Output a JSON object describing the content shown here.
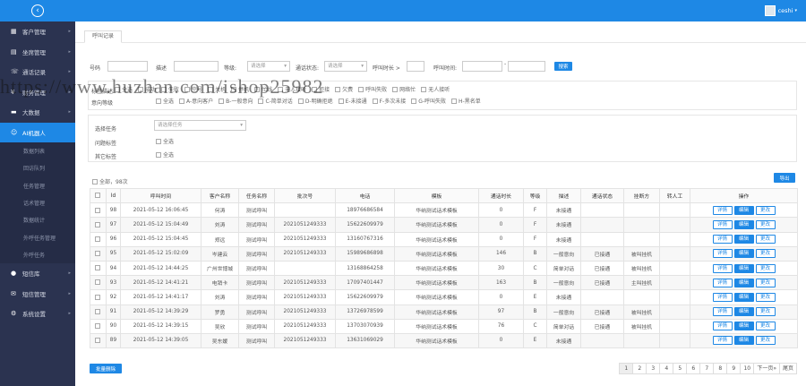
{
  "sidebar": {
    "items": [
      {
        "icon": "▦",
        "label": "客户管理"
      },
      {
        "icon": "▤",
        "label": "坐席管理"
      },
      {
        "icon": "☏",
        "label": "通话记录"
      },
      {
        "icon": "¥",
        "label": "财务管理"
      },
      {
        "icon": "▬",
        "label": "大数据"
      },
      {
        "icon": "☺",
        "label": "AI机器人"
      }
    ],
    "sub": [
      "数据列表",
      "回访队列",
      "任务管理",
      "话术管理",
      "数据统计",
      "外呼任务管理",
      "外呼任务"
    ],
    "items2": [
      {
        "icon": "●",
        "label": "短信库"
      },
      {
        "icon": "✉",
        "label": "短信管理"
      },
      {
        "icon": "⚙",
        "label": "系统设置"
      }
    ]
  },
  "topbar": {
    "user": "ceshi",
    "menu_icon": "‹"
  },
  "tab": "呼叫记录",
  "filters": {
    "phone_label": "号码",
    "desc_label": "描述",
    "level_label": "等级:",
    "level_ph": "请选择",
    "status_label": "通话状态:",
    "status_ph": "请选择",
    "duration_label": "呼叫时长 >",
    "time_label": "呼叫时间:",
    "time_sep": "-",
    "search_btn": "搜索"
  },
  "intent": {
    "row1_label": "标签描述",
    "row1": [
      "全选",
      "成功",
      "失败",
      "空号",
      "关机",
      "停机",
      "忙线",
      "无人接听",
      "拒接",
      "欠费",
      "呼叫失败",
      "网络忙",
      "无人接听"
    ],
    "row2_label": "意向等级",
    "row2": [
      "全选",
      "A-意向客户",
      "B-一般意向",
      "C-简单对话",
      "D-明确拒绝",
      "E-未接通",
      "F-多次未接",
      "G-呼叫失败",
      "H-黑名单"
    ]
  },
  "task": {
    "label": "选择任务",
    "placeholder": "请选择任务",
    "intent_label": "问题标签",
    "all": "全选",
    "tag_label": "其它标签"
  },
  "total": "全部，98次",
  "export_btn": "导出",
  "table": {
    "headers": [
      "",
      "Id",
      "呼叫时间",
      "客户名称",
      "任务名称",
      "批次号",
      "电话",
      "模板",
      "通话时长",
      "等级",
      "描述",
      "通话状态",
      "挂断方",
      "转人工",
      "操作"
    ],
    "rows": [
      [
        "98",
        "2021-05-12 16:06:45",
        "何涛",
        "测试呼叫",
        "",
        "18976686584",
        "华纳测试话术模板",
        "0",
        "F",
        "未接通",
        "",
        "",
        "",
        ""
      ],
      [
        "97",
        "2021-05-12 15:04:49",
        "刘涛",
        "测试呼叫",
        "2021051249333",
        "15622609979",
        "华纳测试话术模板",
        "0",
        "F",
        "未接通",
        "",
        "",
        "",
        ""
      ],
      [
        "96",
        "2021-05-12 15:04:45",
        "郑远",
        "测试呼叫",
        "2021051249333",
        "13160767316",
        "华纳测试话术模板",
        "0",
        "F",
        "未接通",
        "",
        "",
        "",
        ""
      ],
      [
        "95",
        "2021-05-12 15:02:09",
        "岑建云",
        "测试呼叫",
        "2021051249333",
        "15989686898",
        "华纳测试话术模板",
        "146",
        "B",
        "一般意向",
        "已接通",
        "被叫挂机",
        ""
      ],
      [
        "94",
        "2021-05-12 14:44:25",
        "广州世博城",
        "测试呼叫",
        "",
        "13168864258",
        "华纳测试话术模板",
        "30",
        "C",
        "简单对话",
        "已接通",
        "被叫挂机",
        ""
      ],
      [
        "93",
        "2021-05-12 14:41:21",
        "电销卡",
        "测试呼叫",
        "2021051249333",
        "17097401447",
        "华纳测试话术模板",
        "163",
        "B",
        "一般意向",
        "已接通",
        "主叫挂机",
        ""
      ],
      [
        "92",
        "2021-05-12 14:41:17",
        "刘涛",
        "测试呼叫",
        "2021051249333",
        "15622609979",
        "华纳测试话术模板",
        "0",
        "E",
        "未接通",
        "",
        "",
        "",
        ""
      ],
      [
        "91",
        "2021-05-12 14:39:29",
        "罗勇",
        "测试呼叫",
        "2021051249333",
        "13726978599",
        "华纳测试话术模板",
        "97",
        "B",
        "一般意向",
        "已接通",
        "被叫挂机",
        ""
      ],
      [
        "90",
        "2021-05-12 14:39:15",
        "吴欣",
        "测试呼叫",
        "2021051249333",
        "13703070939",
        "华纳测试话术模板",
        "76",
        "C",
        "简单对话",
        "已接通",
        "被叫挂机",
        ""
      ],
      [
        "89",
        "2021-05-12 14:39:05",
        "吴东媛",
        "测试呼叫",
        "2021051249333",
        "13631069029",
        "华纳测试话术模板",
        "0",
        "E",
        "未接通",
        "",
        "",
        "",
        ""
      ]
    ],
    "actions": [
      "详情",
      "编辑",
      "更改"
    ]
  },
  "batch_btn": "批量删除",
  "pager": [
    "1",
    "2",
    "3",
    "4",
    "5",
    "6",
    "7",
    "8",
    "9",
    "10",
    "下一页»",
    "尾页"
  ],
  "watermark": "https://www.huzhan.com/ishop25982"
}
